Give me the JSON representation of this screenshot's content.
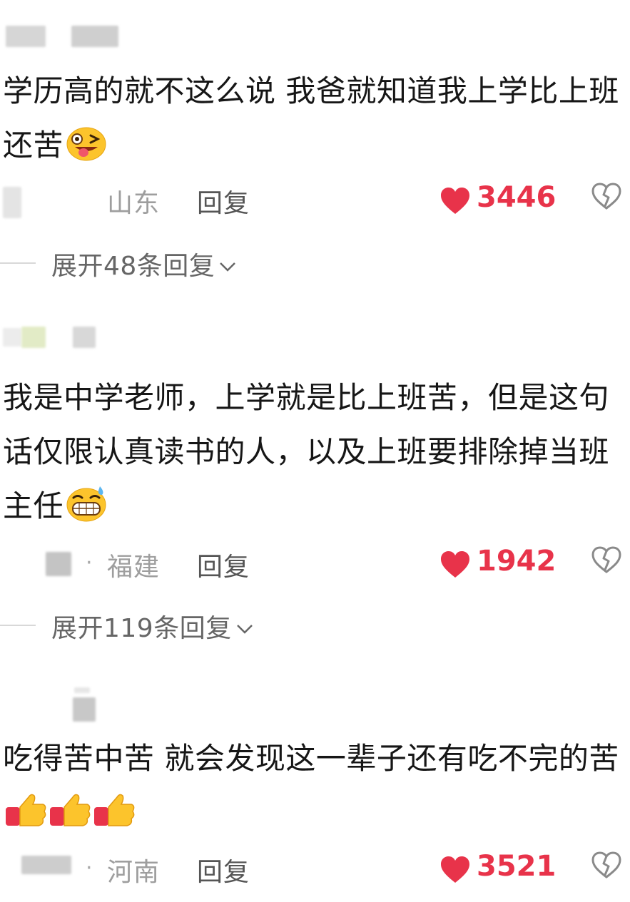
{
  "comments": [
    {
      "text": "学历高的就不这么说 我爸就知道我上学比上班还苦",
      "emoji": "winking-tongue-emoji",
      "location": "山东",
      "reply_label": "回复",
      "likes": "3446",
      "expand_label": "展开48条回复"
    },
    {
      "text": "我是中学老师，上学就是比上班苦，但是这句话仅限认真读书的人，以及上班要排除掉当班主任",
      "emoji": "grin-sweat-emoji",
      "dot": "·",
      "location": "福建",
      "reply_label": "回复",
      "likes": "1942",
      "expand_label": "展开119条回复"
    },
    {
      "text": "吃得苦中苦 就会发现这一辈子还有吃不完的苦",
      "emoji": "thumbs-up-emoji",
      "dot": "·",
      "location": "河南",
      "reply_label": "回复",
      "likes": "3521"
    }
  ],
  "colors": {
    "like_red": "#e8334a",
    "location_gray": "#9e9e9e",
    "reply_gray": "#555555"
  }
}
